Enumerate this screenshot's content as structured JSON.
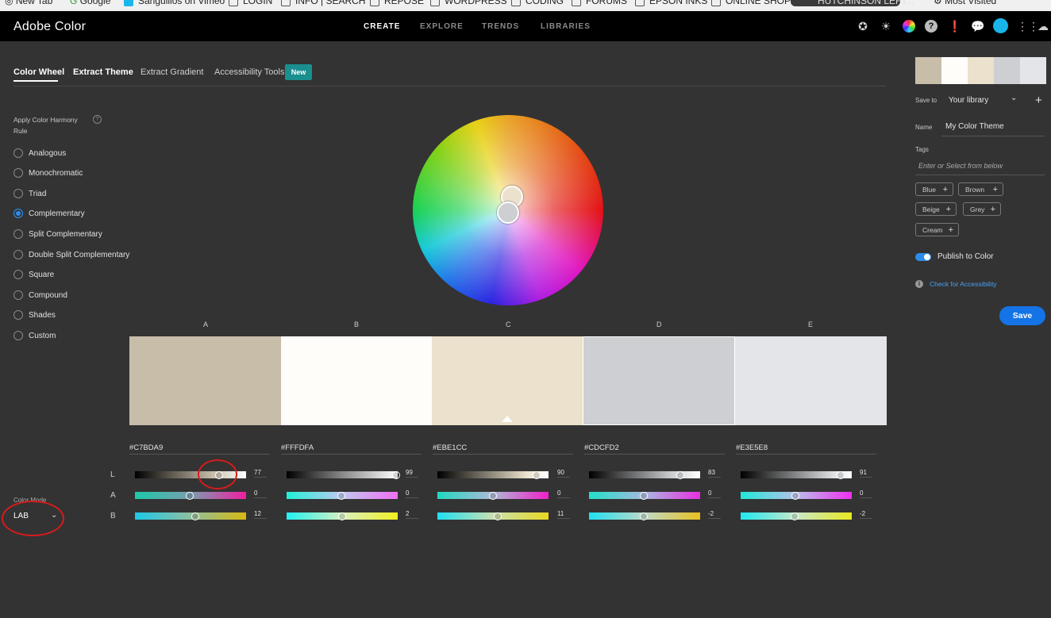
{
  "bookmarks": [
    "New Tab",
    "Google",
    "Sanguillos on Vimeo",
    "LOGIN",
    "INFO | SEARCH",
    "REPOSE",
    "WORDPRESS",
    "CODING",
    "FORUMS",
    "EPSON INKS",
    "ONLINE SHOPPI...",
    "HUTCHINSON LEFT...",
    "Most Visited"
  ],
  "header": {
    "brand": "Adobe Color",
    "nav": [
      "CREATE",
      "EXPLORE",
      "TRENDS",
      "LIBRARIES"
    ],
    "icons": [
      "star-icon",
      "sun-icon",
      "color-wheel-icon",
      "help-icon",
      "feedback-icon",
      "chat-icon",
      "avatar",
      "apps-grid-icon",
      "creative-cloud-icon"
    ]
  },
  "tabs": {
    "items": [
      "Color Wheel",
      "Extract Theme",
      "Extract Gradient",
      "Accessibility Tools"
    ],
    "badge": "New"
  },
  "harmony": {
    "title": "Apply Color Harmony Rule",
    "help": "?",
    "rules": [
      "Analogous",
      "Monochromatic",
      "Triad",
      "Complementary",
      "Split Complementary",
      "Double Split Complementary",
      "Square",
      "Compound",
      "Shades",
      "Custom"
    ],
    "selected": "Complementary"
  },
  "colors": [
    {
      "letter": "A",
      "hex": "#C7BDA9",
      "swatch": "#c7bda9",
      "L": "77",
      "A": "0",
      "B": "12"
    },
    {
      "letter": "B",
      "hex": "#FFFDFA",
      "swatch": "#fffdfa",
      "L": "99",
      "A": "0",
      "B": "2"
    },
    {
      "letter": "C",
      "hex": "#EBE1CC",
      "swatch": "#ebe1cc",
      "L": "90",
      "A": "0",
      "B": "11"
    },
    {
      "letter": "D",
      "hex": "#CDCFD2",
      "swatch": "#cdcfd2",
      "L": "83",
      "A": "0",
      "B": "-2"
    },
    {
      "letter": "E",
      "hex": "#E3E5E8",
      "swatch": "#e3e5e8",
      "L": "91",
      "A": "0",
      "B": "-2"
    }
  ],
  "channels": [
    "L",
    "A",
    "B"
  ],
  "color_mode": {
    "label": "Color Mode",
    "value": "LAB"
  },
  "right_panel": {
    "save_to_label": "Save to",
    "library": "Your library",
    "add": "+",
    "name_label": "Name",
    "name_value": "My Color Theme",
    "tags_label": "Tags",
    "tags_placeholder": "Enter or Select from below",
    "tags": [
      "Blue",
      "Brown",
      "Beige",
      "Grey",
      "Cream"
    ],
    "publish_label": "Publish to Color",
    "accessibility_link": "Check for Accessibility",
    "save_button": "Save"
  }
}
